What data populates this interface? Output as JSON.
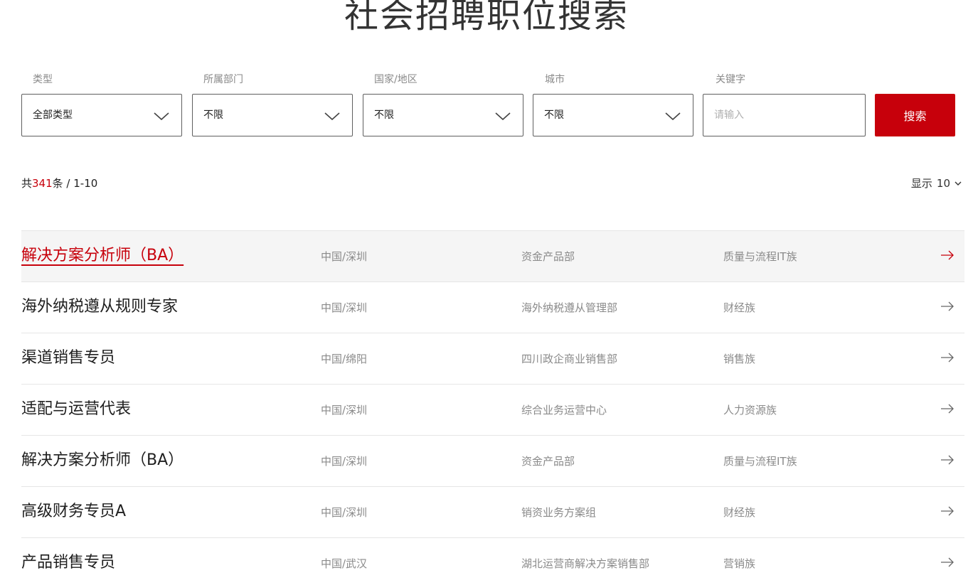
{
  "header": {
    "title": "社会招聘职位搜索"
  },
  "filters": {
    "type": {
      "label": "类型",
      "value": "全部类型"
    },
    "department": {
      "label": "所属部门",
      "value": "不限"
    },
    "country": {
      "label": "国家/地区",
      "value": "不限"
    },
    "city": {
      "label": "城市",
      "value": "不限"
    },
    "keyword": {
      "label": "关键字",
      "placeholder": "请输入",
      "value": ""
    },
    "search_label": "搜索"
  },
  "results": {
    "prefix": "共",
    "total": "341",
    "suffix": "条 / 1-10",
    "page_size_label": "显示",
    "page_size_value": "10"
  },
  "jobs": [
    {
      "title": "解决方案分析师（BA）",
      "location": "中国/深圳",
      "department": "资金产品部",
      "family": "质量与流程IT族"
    },
    {
      "title": "海外纳税遵从规则专家",
      "location": "中国/深圳",
      "department": "海外纳税遵从管理部",
      "family": "财经族"
    },
    {
      "title": "渠道销售专员",
      "location": "中国/绵阳",
      "department": "四川政企商业销售部",
      "family": "销售族"
    },
    {
      "title": "适配与运营代表",
      "location": "中国/深圳",
      "department": "综合业务运营中心",
      "family": "人力资源族"
    },
    {
      "title": "解决方案分析师（BA）",
      "location": "中国/深圳",
      "department": "资金产品部",
      "family": "质量与流程IT族"
    },
    {
      "title": "高级财务专员A",
      "location": "中国/深圳",
      "department": "销资业务方案组",
      "family": "财经族"
    },
    {
      "title": "产品销售专员",
      "location": "中国/武汉",
      "department": "湖北运营商解决方案销售部",
      "family": "营销族"
    }
  ],
  "colors": {
    "accent": "#c7000b",
    "muted_text": "#8a8a8a",
    "row_highlight": "#f5f5f5"
  }
}
